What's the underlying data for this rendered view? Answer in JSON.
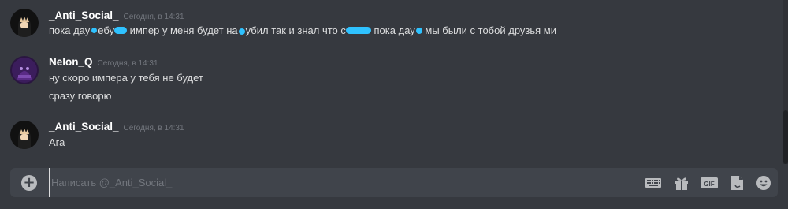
{
  "messages": [
    {
      "username": "_Anti_Social_",
      "timestamp": "Сегодня, в 14:31",
      "lines": [
        {
          "segments": [
            "пока дау",
            "ебу",
            " импер у меня будет на",
            "убил так и знал что с",
            " пока дау",
            " мы были с тобой друзья ми"
          ]
        }
      ]
    },
    {
      "username": "Nelon_Q",
      "timestamp": "Сегодня, в 14:31",
      "lines": [
        {
          "text": "ну скоро импера у тебя не будет"
        },
        {
          "text": "сразу говорю"
        }
      ]
    },
    {
      "username": "_Anti_Social_",
      "timestamp": "Сегодня, в 14:31",
      "lines": [
        {
          "text": "Ага"
        }
      ]
    }
  ],
  "composer": {
    "placeholder": "Написать @_Anti_Social_",
    "tools": [
      "keyboard-icon",
      "gift-icon",
      "gif-icon",
      "sticker-icon",
      "emoji-icon"
    ],
    "gif_label": "GIF"
  },
  "colors": {
    "background": "#36393f",
    "composer": "#40444b",
    "username": "#ffffff",
    "timestamp": "#72767d",
    "text": "#dcddde",
    "redaction": "#2fc2ff"
  }
}
